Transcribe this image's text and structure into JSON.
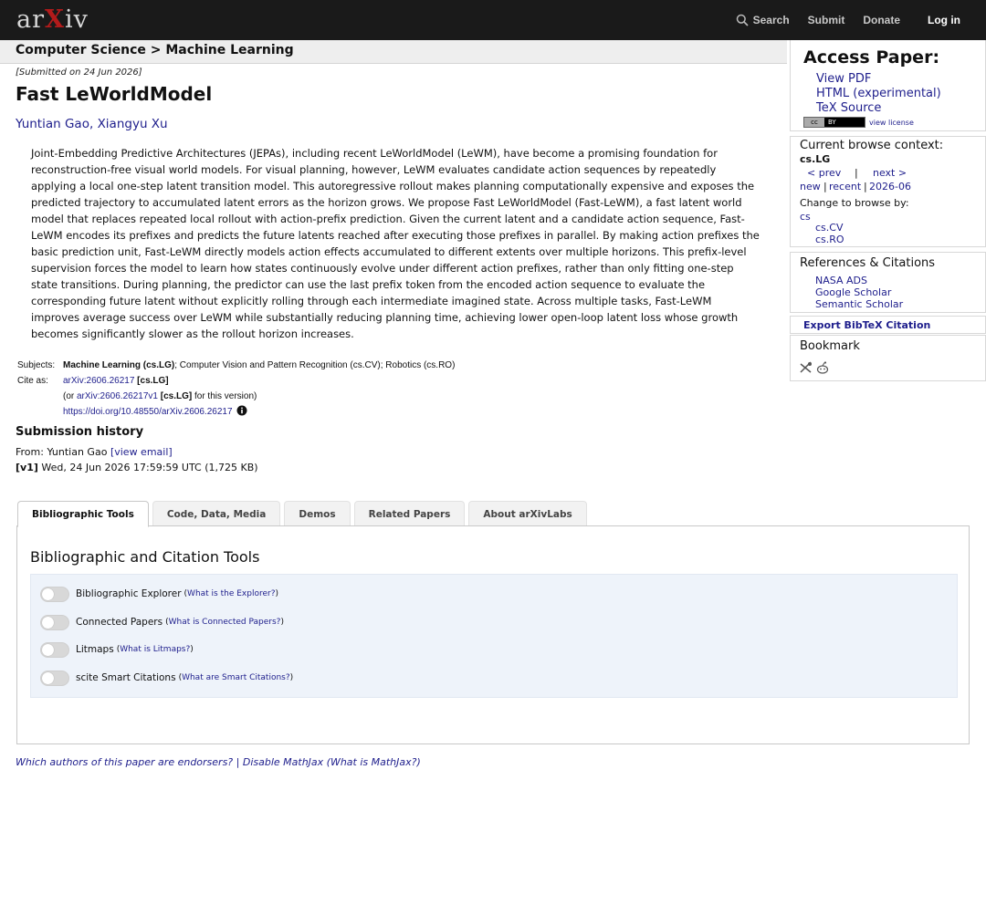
{
  "header": {
    "logo_ar": "ar",
    "logo_x": "X",
    "logo_iv": "iv",
    "search_label": "Search",
    "submit_label": "Submit",
    "donate_label": "Donate",
    "login_label": "Log in"
  },
  "breadcrumb": "Computer Science > Machine Learning",
  "paper": {
    "submitted": "[Submitted on 24 Jun 2026]",
    "title": "Fast LeWorldModel",
    "author1": "Yuntian Gao",
    "author_sep": ", ",
    "author2": "Xiangyu Xu",
    "abstract": "Joint-Embedding Predictive Architectures (JEPAs), including recent LeWorldModel (LeWM), have become a promising foundation for reconstruction-free visual world models. For visual planning, however, LeWM evaluates candidate action sequences by repeatedly applying a local one-step latent transition model. This autoregressive rollout makes planning computationally expensive and exposes the predicted trajectory to accumulated latent errors as the horizon grows. We propose Fast LeWorldModel (Fast-LeWM), a fast latent world model that replaces repeated local rollout with action-prefix prediction. Given the current latent and a candidate action sequence, Fast-LeWM encodes its prefixes and predicts the future latents reached after executing those prefixes in parallel. By making action prefixes the basic prediction unit, Fast-LeWM directly models action effects accumulated to different extents over multiple horizons. This prefix-level supervision forces the model to learn how states continuously evolve under different action prefixes, rather than only fitting one-step state transitions. During planning, the predictor can use the last prefix token from the encoded action sequence to evaluate the corresponding future latent without explicitly rolling through each intermediate imagined state. Across multiple tasks, Fast-LeWM improves average success over LeWM while substantially reducing planning time, achieving lower open-loop latent loss whose growth becomes significantly slower as the rollout horizon increases."
  },
  "meta": {
    "subjects_label": "Subjects:",
    "subjects_main": "Machine Learning (cs.LG)",
    "subjects_rest": "; Computer Vision and Pattern Recognition (cs.CV); Robotics (cs.RO)",
    "cite_label": "Cite as:",
    "cite_id": "arXiv:2606.26217",
    "cite_cat": " [cs.LG]",
    "cite_or": "(or ",
    "cite_v1": "arXiv:2606.26217v1",
    "cite_v1_cat": " [cs.LG]",
    "cite_v1_tail": " for this version)",
    "doi": "https://doi.org/10.48550/arXiv.2606.26217"
  },
  "history": {
    "title": "Submission history",
    "from_prefix": "From: Yuntian Gao ",
    "view_email": "[view email]",
    "v1_label": "[v1]",
    "v1_text": " Wed, 24 Jun 2026 17:59:59 UTC (1,725 KB)"
  },
  "tabs": [
    {
      "label": "Bibliographic Tools"
    },
    {
      "label": "Code, Data, Media"
    },
    {
      "label": "Demos"
    },
    {
      "label": "Related Papers"
    },
    {
      "label": "About arXivLabs"
    }
  ],
  "panel": {
    "title": "Bibliographic and Citation Tools",
    "tools": [
      {
        "name": "Bibliographic Explorer",
        "help": "What is the Explorer?"
      },
      {
        "name": "Connected Papers",
        "help": "What is Connected Papers?"
      },
      {
        "name": "Litmaps",
        "help": "What is Litmaps?"
      },
      {
        "name": "scite Smart Citations",
        "help": "What are Smart Citations?"
      }
    ]
  },
  "footer": {
    "endorsers": "Which authors of this paper are endorsers?",
    "sep": " | ",
    "disable_mathjax": "Disable MathJax",
    "what_mathjax": " (What is MathJax?)"
  },
  "sidebar": {
    "access_title": "Access Paper:",
    "view_pdf": "View PDF",
    "html": "HTML (experimental)",
    "tex": "TeX Source",
    "cc_left": "cc",
    "cc_right": "BY",
    "view_license": "view license",
    "context_title": "Current browse context:",
    "context": "cs.LG",
    "prev": "< prev",
    "bar": "|",
    "next": "next >",
    "new": "new",
    "recent": "recent",
    "month": "2026-06",
    "change_label": "Change to browse by:",
    "cs": "cs",
    "cs_cv": "cs.CV",
    "cs_ro": "cs.RO",
    "refs_title": "References & Citations",
    "nasa": "NASA ADS",
    "google": "Google Scholar",
    "semantic": "Semantic Scholar",
    "export": "Export BibTeX Citation",
    "bookmark": "Bookmark"
  }
}
